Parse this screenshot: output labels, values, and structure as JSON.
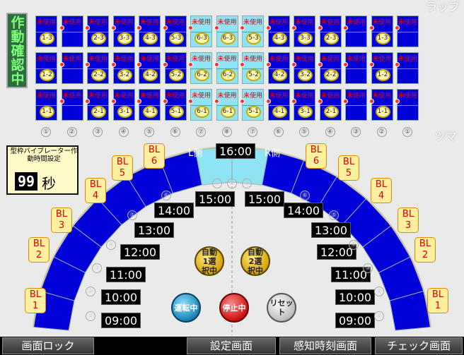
{
  "status": {
    "text": "作動確認中"
  },
  "corner_labels": {
    "lap": "ラップ",
    "tsuma": "ツマ"
  },
  "grid": {
    "unused_label": "未使用",
    "rows": [
      {
        "coins": [
          "1-3",
          "",
          "2-3",
          "3-3",
          "4-3",
          "5-3",
          "6-3",
          "6-3",
          "5-3",
          "4-3",
          "3-3",
          "2-3",
          "",
          "1-3",
          ""
        ]
      },
      {
        "coins": [
          "1-2",
          "",
          "2-2",
          "3-2",
          "4-2",
          "5-2",
          "6-2",
          "6-2",
          "5-2",
          "4-2",
          "3-2",
          "2-2",
          "",
          "1-2",
          ""
        ]
      },
      {
        "coins": [
          "1-1",
          "",
          "2-1",
          "3-1",
          "4-1",
          "5-1",
          "6-1",
          "6-1",
          "5-1",
          "4-1",
          "3-1",
          "2-1",
          "",
          "1-1",
          ""
        ]
      }
    ],
    "column_numbers": [
      "①",
      "②",
      "③",
      "④",
      "⑤",
      "⑥",
      "⑦",
      "⑧",
      "⑦",
      "⑥",
      "⑤",
      "④",
      "③",
      "②",
      "①"
    ]
  },
  "vibrator": {
    "title": "型枠バイブレーター作動時間設定",
    "value": "99",
    "unit": "秒"
  },
  "sides": {
    "left": "L側",
    "right": "R側",
    "top_time": "16:00"
  },
  "bl_left": [
    {
      "line1": "BL",
      "line2": "1"
    },
    {
      "line1": "BL",
      "line2": "2"
    },
    {
      "line1": "BL",
      "line2": "3"
    },
    {
      "line1": "BL",
      "line2": "4"
    },
    {
      "line1": "BL",
      "line2": "5"
    },
    {
      "line1": "BL",
      "line2": "6"
    }
  ],
  "bl_right": [
    {
      "line1": "BL",
      "line2": "6"
    },
    {
      "line1": "BL",
      "line2": "5"
    },
    {
      "line1": "BL",
      "line2": "4"
    },
    {
      "line1": "BL",
      "line2": "3"
    },
    {
      "line1": "BL",
      "line2": "2"
    },
    {
      "line1": "BL",
      "line2": "1"
    }
  ],
  "times": [
    "09:00",
    "10:00",
    "11:00",
    "12:00",
    "13:00",
    "14:00",
    "15:00"
  ],
  "levels": [
    "①",
    "②",
    "③",
    "④",
    "⑤",
    "⑥",
    "⑦",
    "⑧"
  ],
  "buttons": {
    "auto1": "自動1選択中",
    "auto2": "自動2選択中",
    "run": "運転中",
    "stop": "停止中",
    "reset": "リセット"
  },
  "bottom": {
    "lock": "画面ロック",
    "settings": "設定画面",
    "sensing": "感知時刻画面",
    "check": "チェック画面"
  },
  "colors": {
    "bar_blue": "#0000d8",
    "cyan": "#8ee4f2",
    "unused_red": "#ee0000",
    "status_green": "#7dff7a"
  }
}
